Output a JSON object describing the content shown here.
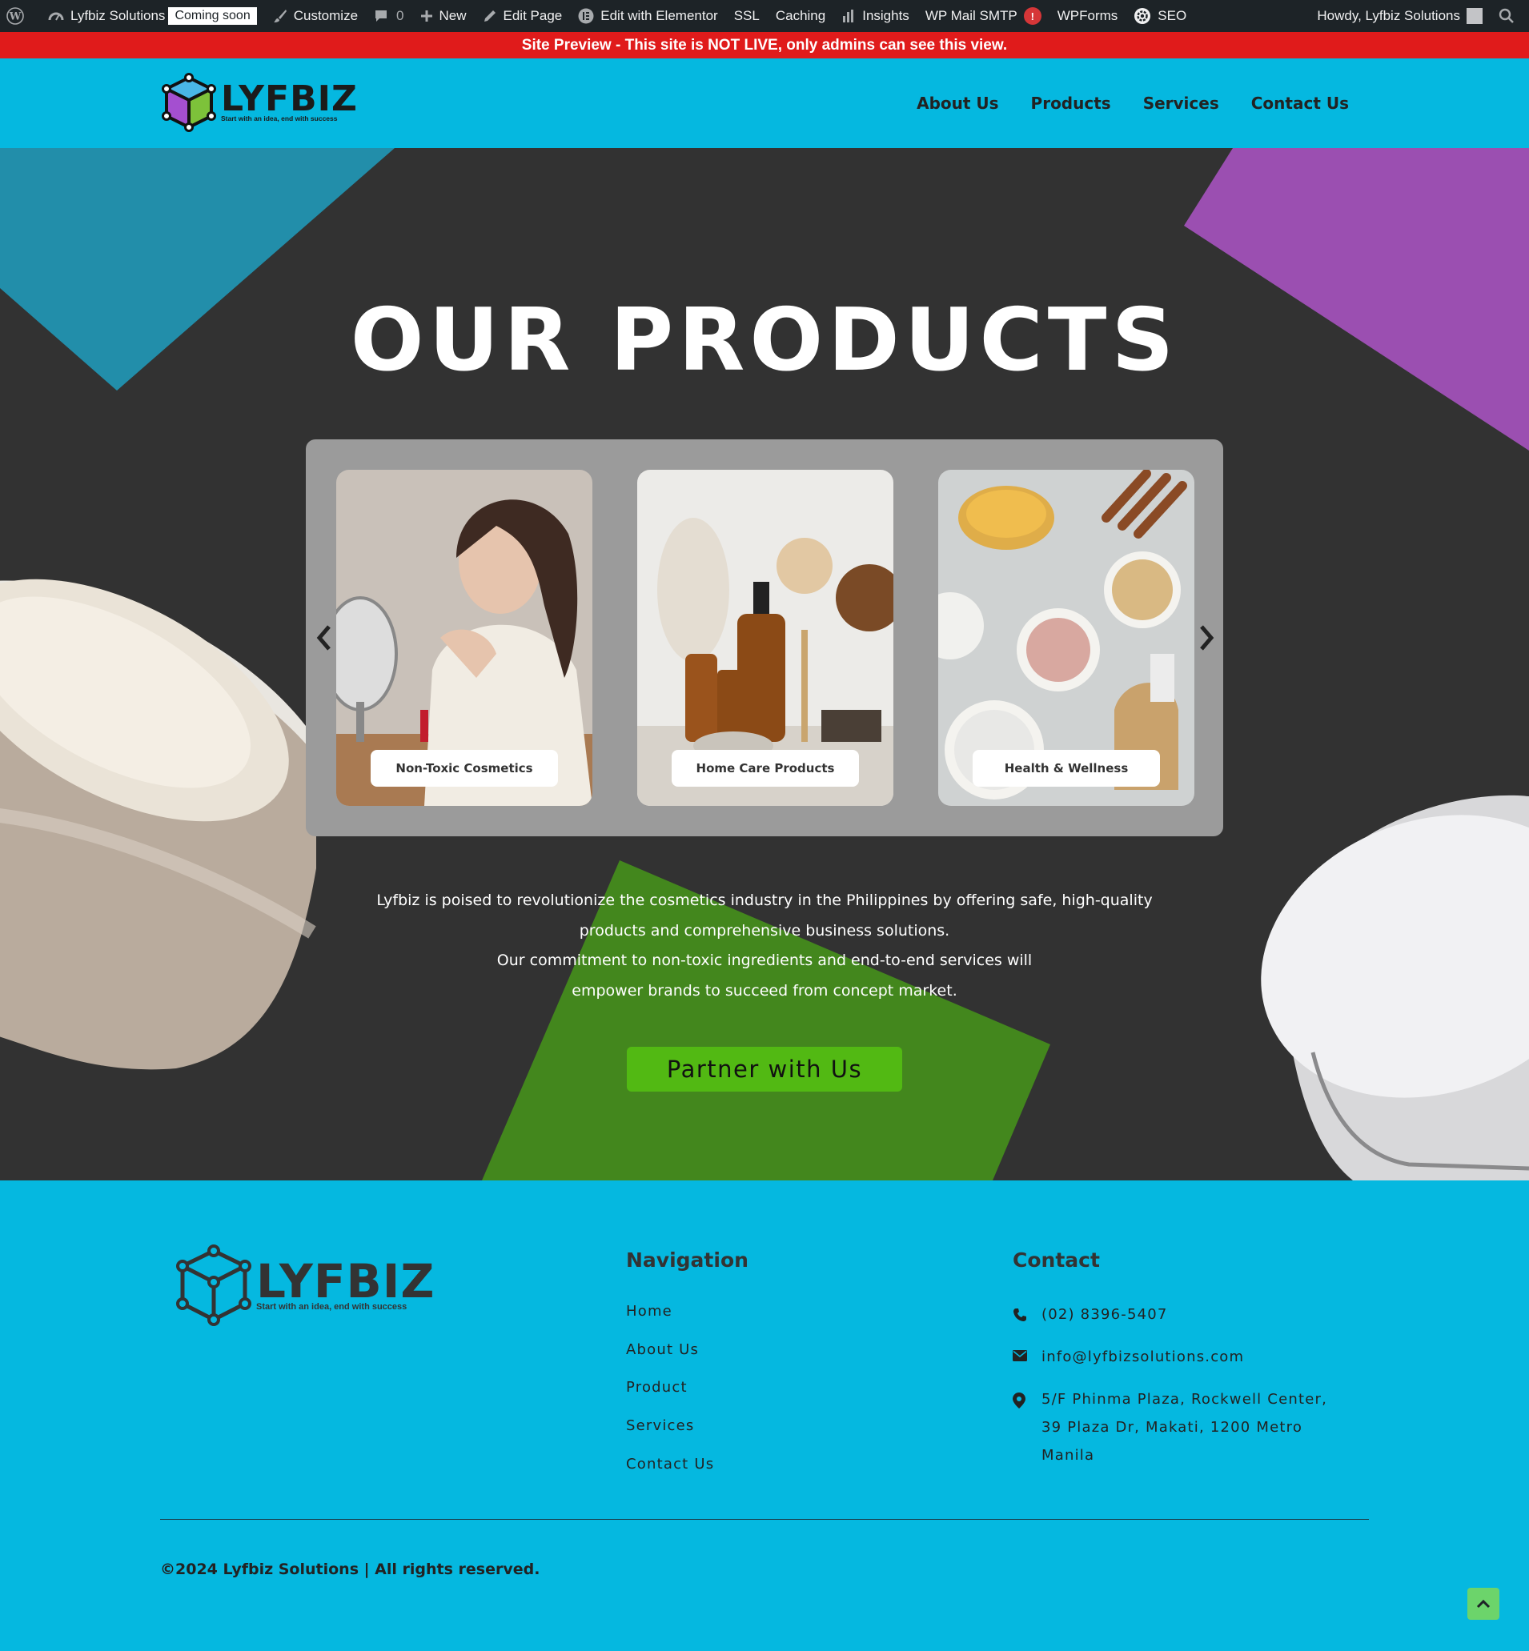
{
  "adminbar": {
    "site_name": "Lyfbiz Solutions",
    "coming_soon": "Coming soon",
    "customize": "Customize",
    "comments_count": "0",
    "new": "New",
    "edit_page": "Edit Page",
    "edit_elementor": "Edit with Elementor",
    "ssl": "SSL",
    "caching": "Caching",
    "insights": "Insights",
    "wp_mail_smtp": "WP Mail SMTP",
    "smtp_alert": "!",
    "wpforms": "WPForms",
    "seo": "SEO",
    "howdy": "Howdy, Lyfbiz Solutions"
  },
  "preview_banner": "Site Preview - This site is NOT LIVE, only admins can see this view.",
  "header": {
    "logo_word": "LYFBIZ",
    "logo_tagline": "Start with an idea, end with success",
    "nav": [
      "About Us",
      "Products",
      "Services",
      "Contact Us"
    ]
  },
  "hero": {
    "title": "OUR PRODUCTS",
    "cards": [
      {
        "label": "Non-Toxic Cosmetics"
      },
      {
        "label": "Home Care Products"
      },
      {
        "label": "Health & Wellness"
      }
    ],
    "description_lines": [
      "Lyfbiz is poised to revolutionize the cosmetics industry in the Philippines by offering safe, high-quality",
      "products and comprehensive business solutions.",
      "Our commitment to non-toxic ingredients and end-to-end services will",
      "empower brands to succeed from concept market."
    ],
    "cta": "Partner with Us"
  },
  "footer": {
    "logo_word": "LYFBIZ",
    "logo_tagline": "Start with an idea, end with success",
    "nav_title": "Navigation",
    "nav_links": [
      "Home",
      "About Us",
      "Product",
      "Services",
      "Contact Us"
    ],
    "contact_title": "Contact",
    "phone": "(02) 8396-5407",
    "email": "info@lyfbizsolutions.com",
    "address_lines": [
      "5/F Phinma Plaza, Rockwell Center,",
      "39 Plaza Dr, Makati, 1200 Metro",
      "Manila"
    ],
    "copyright": "©2024 Lyfbiz Solutions | All rights reserved."
  },
  "colors": {
    "brand_cyan": "#05b8e0",
    "hero_bg": "#323232",
    "accent_green": "#52b913",
    "accent_purple": "#9b4fb1",
    "alert_red": "#e01b1b"
  }
}
